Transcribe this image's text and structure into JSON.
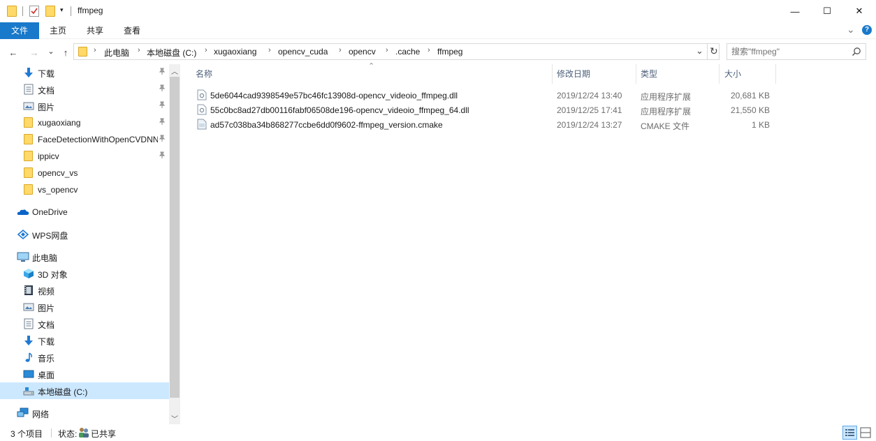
{
  "window": {
    "title": "ffmpeg",
    "controls": {
      "minimize": "—",
      "maximize": "☐",
      "close": "✕"
    }
  },
  "ribbon": {
    "tabs": [
      "文件",
      "主页",
      "共享",
      "查看"
    ],
    "collapse": "⌄",
    "help": "?"
  },
  "nav": {
    "back": "←",
    "forward": "→",
    "recent": "⌄",
    "up": "↑",
    "refresh": "↻",
    "dropdown": "⌄"
  },
  "address": {
    "crumbs": [
      "此电脑",
      "本地磁盘 (C:)",
      "xugaoxiang",
      "opencv_cuda",
      "opencv",
      ".cache",
      "ffmpeg"
    ]
  },
  "search": {
    "placeholder": "搜索\"ffmpeg\"",
    "icon": "search-icon"
  },
  "sidebar": {
    "quick_access": [
      {
        "label": "下载",
        "icon": "download-icon",
        "pinned": true
      },
      {
        "label": "文档",
        "icon": "document-icon",
        "pinned": true
      },
      {
        "label": "图片",
        "icon": "picture-icon",
        "pinned": true
      },
      {
        "label": "xugaoxiang",
        "icon": "folder-icon",
        "pinned": true
      },
      {
        "label": "FaceDetectionWithOpenCVDNN",
        "icon": "folder-icon",
        "pinned": true
      },
      {
        "label": "ippicv",
        "icon": "folder-icon",
        "pinned": true
      },
      {
        "label": "opencv_vs",
        "icon": "folder-icon",
        "pinned": false
      },
      {
        "label": "vs_opencv",
        "icon": "folder-icon",
        "pinned": false
      }
    ],
    "onedrive": "OneDrive",
    "wps": "WPS网盘",
    "this_pc": "此电脑",
    "pc_items": [
      {
        "label": "3D 对象",
        "icon": "3d-objects-icon"
      },
      {
        "label": "视频",
        "icon": "video-icon"
      },
      {
        "label": "图片",
        "icon": "picture-icon"
      },
      {
        "label": "文档",
        "icon": "document-icon"
      },
      {
        "label": "下载",
        "icon": "download-icon"
      },
      {
        "label": "音乐",
        "icon": "music-icon"
      },
      {
        "label": "桌面",
        "icon": "desktop-icon"
      },
      {
        "label": "本地磁盘 (C:)",
        "icon": "drive-icon",
        "selected": true
      }
    ],
    "network": "网络",
    "pin_glyph": "📌"
  },
  "list": {
    "columns": {
      "name": "名称",
      "modified": "修改日期",
      "type": "类型",
      "size": "大小"
    },
    "sort_indicator": "⌃",
    "rows": [
      {
        "name": "5de6044cad9398549e57bc46fc13908d-opencv_videoio_ffmpeg.dll",
        "modified": "2019/12/24 13:40",
        "type": "应用程序扩展",
        "size": "20,681 KB",
        "icon": "dll-file-icon"
      },
      {
        "name": "55c0bc8ad27db00116fabf06508de196-opencv_videoio_ffmpeg_64.dll",
        "modified": "2019/12/25 17:41",
        "type": "应用程序扩展",
        "size": "21,550 KB",
        "icon": "dll-file-icon"
      },
      {
        "name": "ad57c038ba34b868277ccbe6dd0f9602-ffmpeg_version.cmake",
        "modified": "2019/12/24 13:27",
        "type": "CMAKE 文件",
        "size": "1 KB",
        "icon": "cmake-file-icon"
      }
    ]
  },
  "status": {
    "count": "3 个项目",
    "state_label": "状态:",
    "state_value": "已共享"
  }
}
